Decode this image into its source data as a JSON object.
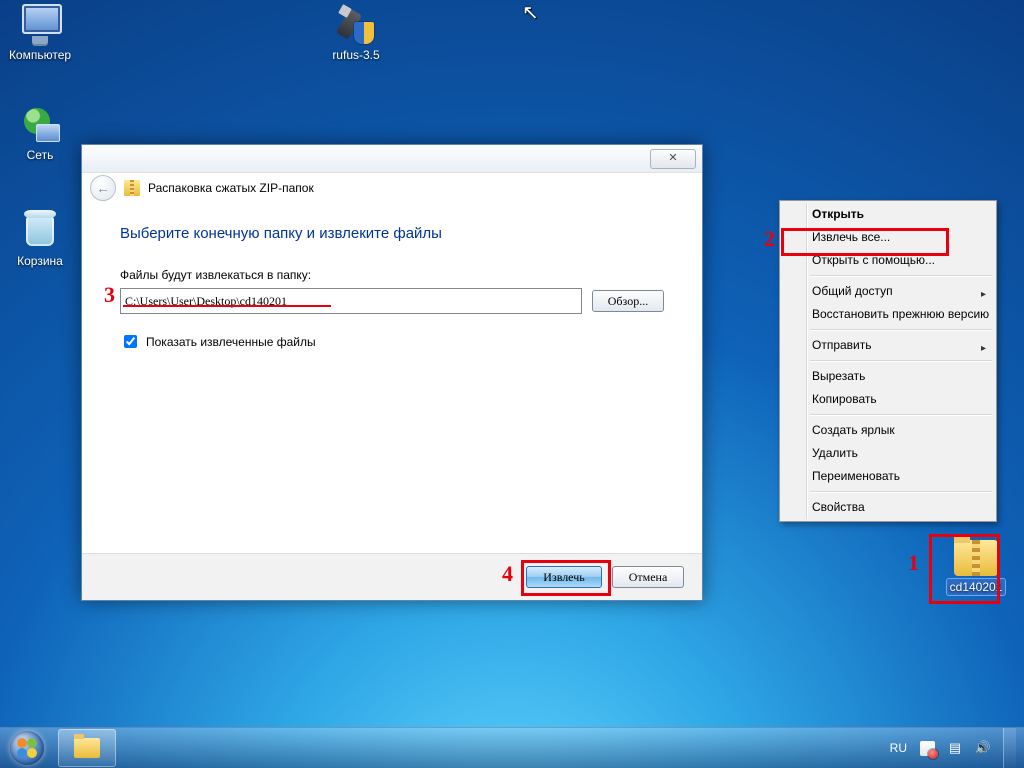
{
  "desktop": {
    "icons": {
      "computer": "Компьютер",
      "network": "Сеть",
      "recycle": "Корзина",
      "rufus": "rufus-3.5",
      "zip": "cd140201"
    }
  },
  "wizard": {
    "close_glyph": "✕",
    "back_glyph": "←",
    "crumb": "Распаковка сжатых ZIP-папок",
    "heading": "Выберите конечную папку и извлеките файлы",
    "dest_label": "Файлы будут извлекаться в папку:",
    "dest_value": "C:\\Users\\User\\Desktop\\cd140201",
    "browse": "Обзор...",
    "show_when_done": "Показать извлеченные файлы",
    "extract": "Извлечь",
    "cancel": "Отмена"
  },
  "ctx": {
    "open": "Открыть",
    "extract_all": "Извлечь все...",
    "open_with": "Открыть с помощью...",
    "share": "Общий доступ",
    "restore": "Восстановить прежнюю версию",
    "send_to": "Отправить",
    "cut": "Вырезать",
    "copy": "Копировать",
    "shortcut": "Создать ярлык",
    "delete": "Удалить",
    "rename": "Переименовать",
    "properties": "Свойства"
  },
  "anno": {
    "n1": "1",
    "n2": "2",
    "n3": "3",
    "n4": "4"
  },
  "taskbar": {
    "lang": "RU"
  }
}
